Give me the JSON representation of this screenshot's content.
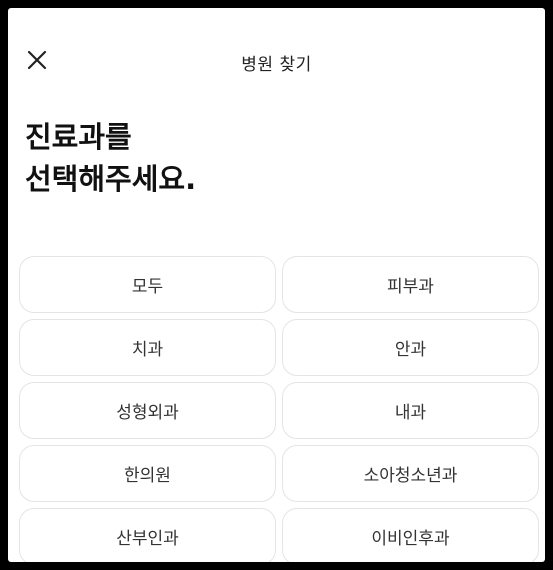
{
  "header": {
    "title": "병원 찾기",
    "close_icon": "close-icon"
  },
  "main": {
    "title_line1": "진료과를",
    "title_line2": "선택해주세요."
  },
  "departments": [
    {
      "label": "모두"
    },
    {
      "label": "피부과"
    },
    {
      "label": "치과"
    },
    {
      "label": "안과"
    },
    {
      "label": "성형외과"
    },
    {
      "label": "내과"
    },
    {
      "label": "한의원"
    },
    {
      "label": "소아청소년과"
    },
    {
      "label": "산부인과"
    },
    {
      "label": "이비인후과"
    }
  ],
  "colors": {
    "background": "#ffffff",
    "button_border": "#e4e4e4",
    "text": "#111111"
  }
}
